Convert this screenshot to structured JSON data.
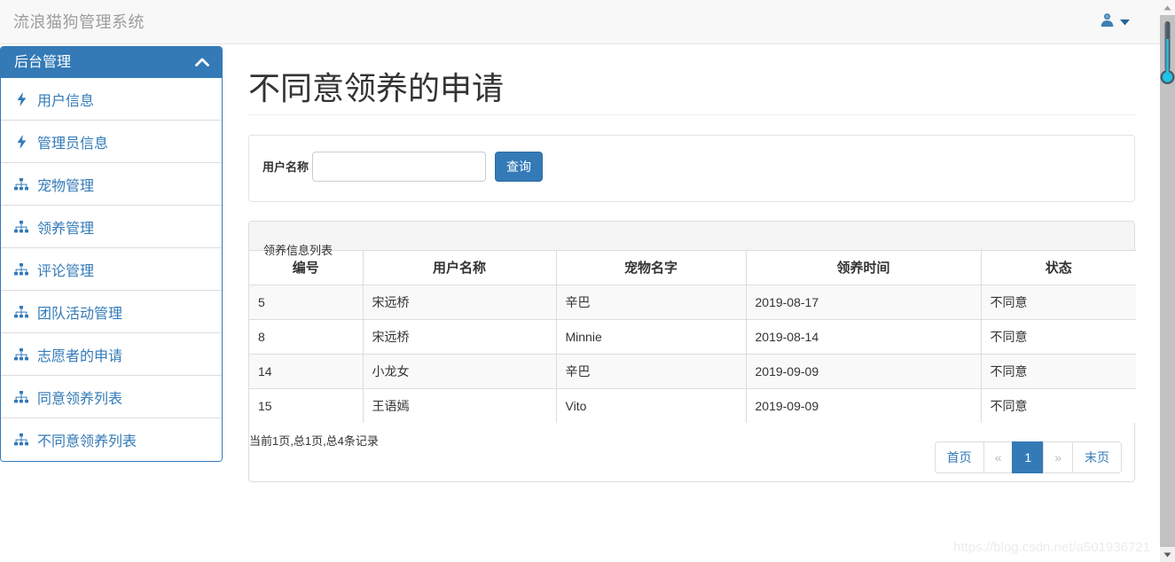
{
  "navbar": {
    "brand": "流浪猫狗管理系统",
    "user_icon": "user-icon",
    "caret_icon": "caret-down-icon"
  },
  "sidebar": {
    "heading": "后台管理",
    "collapse_icon": "chevron-up-icon",
    "items": [
      {
        "label": "用户信息",
        "icon": "bolt-icon"
      },
      {
        "label": "管理员信息",
        "icon": "bolt-icon"
      },
      {
        "label": "宠物管理",
        "icon": "sitemap-icon"
      },
      {
        "label": "领养管理",
        "icon": "sitemap-icon"
      },
      {
        "label": "评论管理",
        "icon": "sitemap-icon"
      },
      {
        "label": "团队活动管理",
        "icon": "sitemap-icon"
      },
      {
        "label": "志愿者的申请",
        "icon": "sitemap-icon"
      },
      {
        "label": "同意领养列表",
        "icon": "sitemap-icon"
      },
      {
        "label": "不同意领养列表",
        "icon": "sitemap-icon"
      }
    ]
  },
  "main": {
    "page_title": "不同意领养的申请",
    "search": {
      "label": "用户名称",
      "value": "",
      "placeholder": "",
      "button": "查询"
    },
    "table": {
      "panel_title": "领养信息列表",
      "columns": [
        "编号",
        "用户名称",
        "宠物名字",
        "领养时间",
        "状态"
      ],
      "rows": [
        [
          "5",
          "宋远桥",
          "辛巴",
          "2019-08-17",
          "不同意"
        ],
        [
          "8",
          "宋远桥",
          "Minnie",
          "2019-08-14",
          "不同意"
        ],
        [
          "14",
          "小龙女",
          "辛巴",
          "2019-09-09",
          "不同意"
        ],
        [
          "15",
          "王语嫣",
          "Vito",
          "2019-09-09",
          "不同意"
        ]
      ]
    },
    "page_info": "当前1页,总1页,总4条记录",
    "pagination": {
      "first": "首页",
      "prev": "«",
      "current": "1",
      "next": "»",
      "last": "末页"
    }
  },
  "watermark": "https://blog.csdn.net/a501936721",
  "colors": {
    "primary": "#337ab7",
    "navbar_bg": "#f8f8f8",
    "brand_text": "#9d9d9d",
    "panel_heading_bg": "#f5f5f5",
    "stripe": "#f9f9f9",
    "border": "#dddddd"
  }
}
